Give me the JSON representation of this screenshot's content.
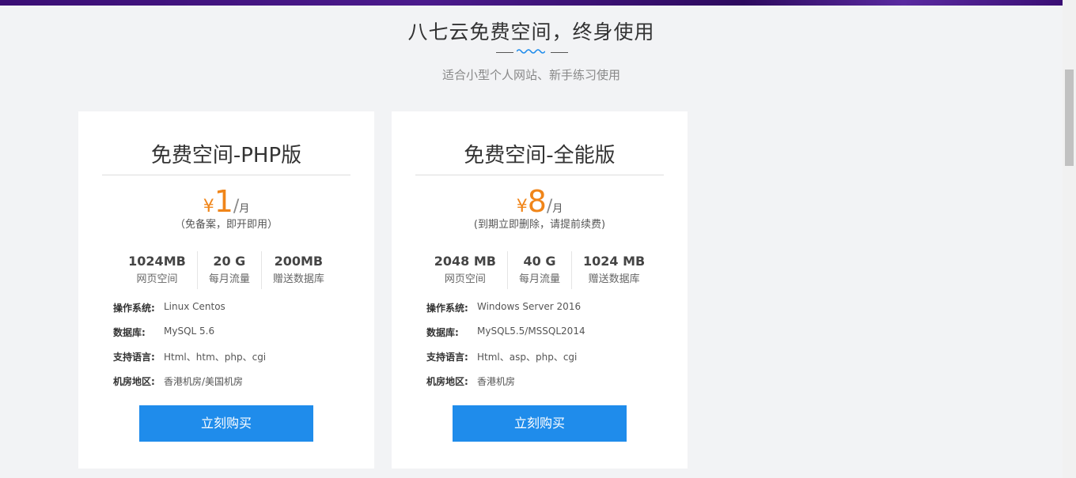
{
  "heading": {
    "title": "八七云免费空间，终身使用",
    "subtitle": "适合小型个人网站、新手练习使用"
  },
  "colors": {
    "accent_price": "#f08519",
    "button": "#1f8ceb",
    "banner": "#3a0e74"
  },
  "cards": [
    {
      "title": "免费空间-PHP版",
      "price": {
        "currency": "¥",
        "amount": "1",
        "slash": "/",
        "unit": "月"
      },
      "note": "（免备案，即开即用）",
      "specs": [
        {
          "value": "1024MB",
          "label": "网页空间"
        },
        {
          "value": "20 G",
          "label": "每月流量"
        },
        {
          "value": "200MB",
          "label": "赠送数据库"
        }
      ],
      "details": [
        {
          "key": "操作系统:",
          "value": "Linux Centos"
        },
        {
          "key": "数据库:",
          "value": "MySQL 5.6"
        },
        {
          "key": "支持语言:",
          "value": "Html、htm、php、cgi"
        },
        {
          "key": "机房地区:",
          "value": "香港机房/美国机房"
        }
      ],
      "button": "立刻购买"
    },
    {
      "title": "免费空间-全能版",
      "price": {
        "currency": "¥",
        "amount": "8",
        "slash": "/",
        "unit": "月"
      },
      "note": "(到期立即删除，请提前续费)",
      "specs": [
        {
          "value": "2048 MB",
          "label": "网页空间"
        },
        {
          "value": "40 G",
          "label": "每月流量"
        },
        {
          "value": "1024 MB",
          "label": "赠送数据库"
        }
      ],
      "details": [
        {
          "key": "操作系统:",
          "value": "Windows Server 2016"
        },
        {
          "key": "数据库:",
          "value": "MySQL5.5/MSSQL2014"
        },
        {
          "key": "支持语言:",
          "value": "Html、asp、php、cgi"
        },
        {
          "key": "机房地区:",
          "value": "香港机房"
        }
      ],
      "button": "立刻购买"
    }
  ]
}
